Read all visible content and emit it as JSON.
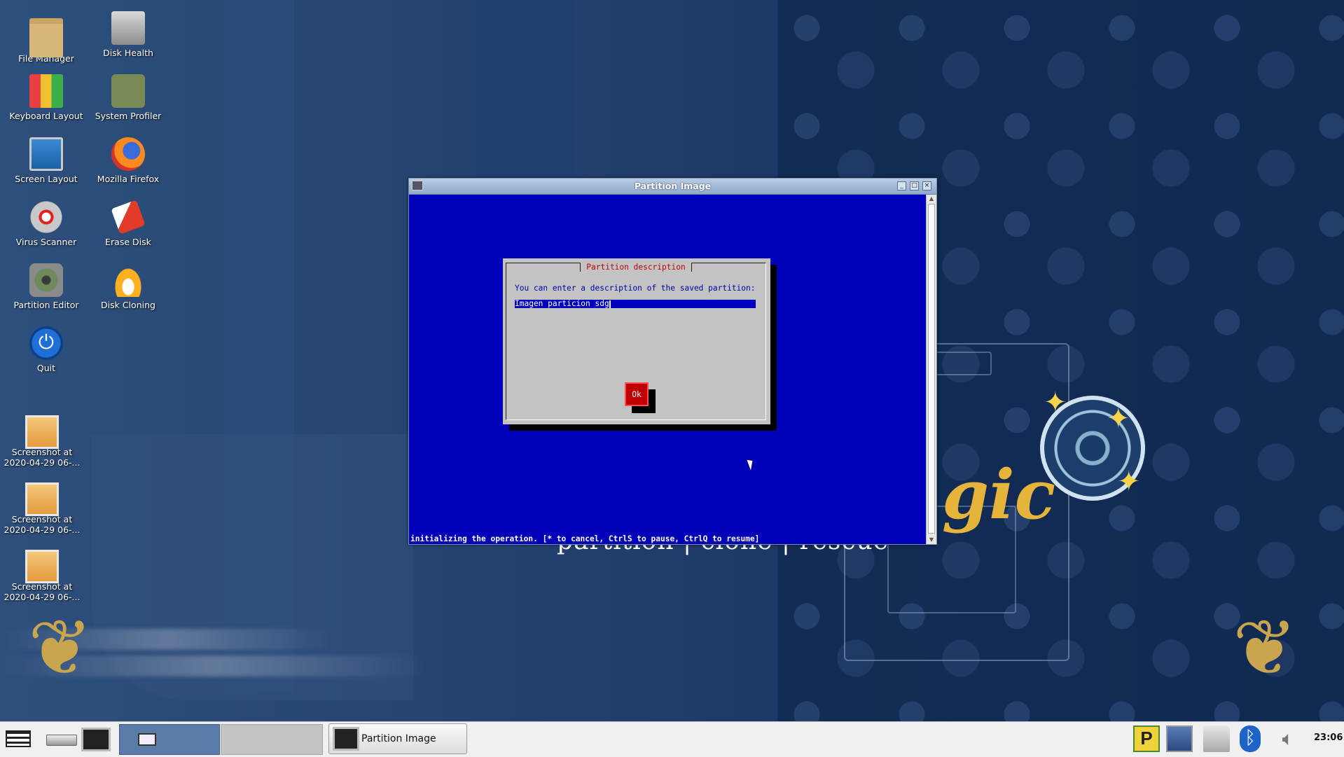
{
  "desktop": {
    "icons": [
      {
        "label": "File Manager",
        "icon": "folder-icon"
      },
      {
        "label": "Disk Health",
        "icon": "disk-health-icon"
      },
      {
        "label": "Keyboard Layout",
        "icon": "keyboard-layout-icon"
      },
      {
        "label": "System Profiler",
        "icon": "system-profiler-icon"
      },
      {
        "label": "Screen Layout",
        "icon": "monitor-icon"
      },
      {
        "label": "Mozilla Firefox",
        "icon": "firefox-icon"
      },
      {
        "label": "Virus Scanner",
        "icon": "virus-scanner-icon"
      },
      {
        "label": "Erase Disk",
        "icon": "eraser-icon"
      },
      {
        "label": "Partition Editor",
        "icon": "partition-editor-icon"
      },
      {
        "label": "Disk Cloning",
        "icon": "disk-cloning-icon"
      },
      {
        "label": "Quit",
        "icon": "power-icon"
      },
      {
        "label": "Screenshot at\n2020-04-29 06-...",
        "icon": "image-icon"
      },
      {
        "label": "Screenshot at\n2020-04-29 06-...",
        "icon": "image-icon"
      },
      {
        "label": "Screenshot at\n2020-04-29 06-...",
        "icon": "image-icon"
      }
    ]
  },
  "wallpaper": {
    "tagline": "partition | clone | rescue",
    "logo_text": "gic"
  },
  "window": {
    "title": "Partition Image",
    "controls": {
      "minimize": "_",
      "maximize": "□",
      "close": "×"
    },
    "dialog": {
      "title": "Partition description",
      "prompt": "You can enter a description of the saved partition:",
      "input_value": "Imagen particion sdg",
      "ok_label": "Ok"
    },
    "status_line": "initializing the operation. [* to cancel, CtrlS to pause, CtrlQ to resume]"
  },
  "taskbar": {
    "task_label": "Partition Image",
    "clock": "23:06",
    "tray_p_label": "P",
    "colors": {
      "accent": "#0000b8",
      "dialog": "#c3c3c3",
      "ok": "#c00000"
    }
  }
}
